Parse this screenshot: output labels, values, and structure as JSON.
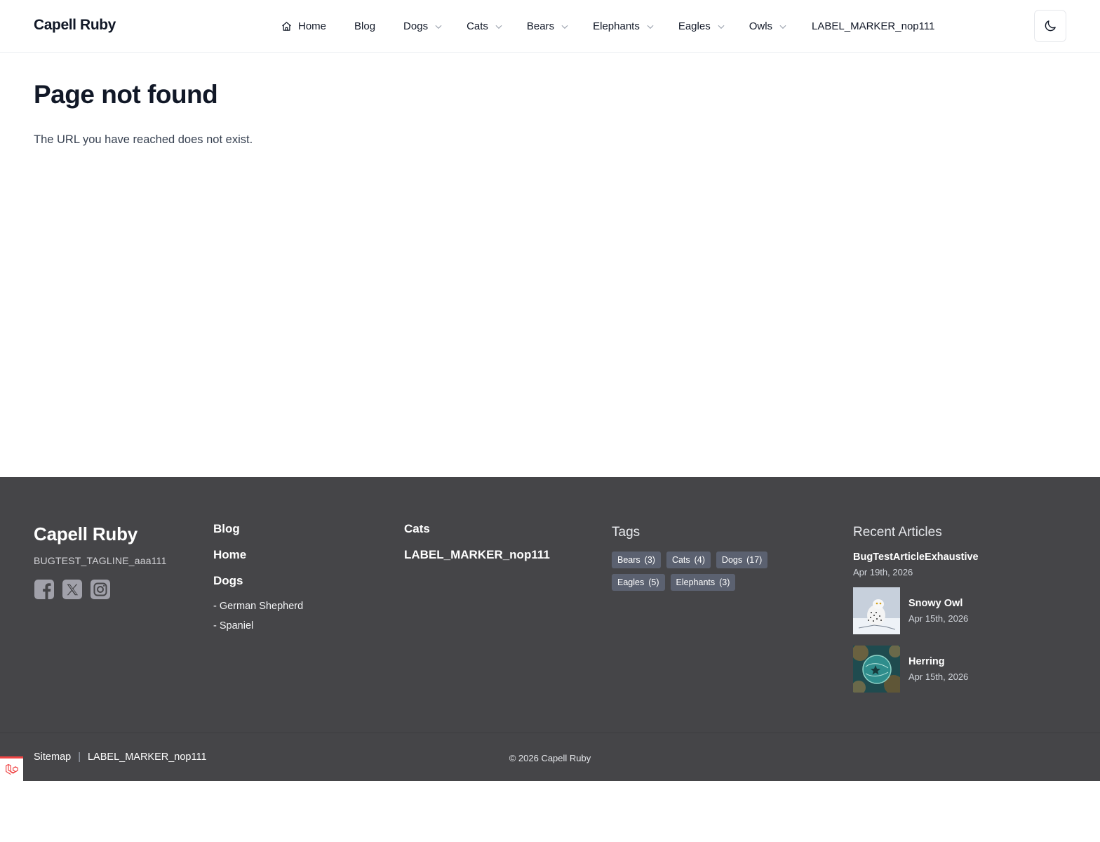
{
  "header": {
    "brand": "Capell Ruby",
    "nav": [
      {
        "label": "Home",
        "icon": "home-icon",
        "dropdown": false
      },
      {
        "label": "Blog",
        "dropdown": false
      },
      {
        "label": "Dogs",
        "dropdown": true
      },
      {
        "label": "Cats",
        "dropdown": true
      },
      {
        "label": "Bears",
        "dropdown": true
      },
      {
        "label": "Elephants",
        "dropdown": true
      },
      {
        "label": "Eagles",
        "dropdown": true
      },
      {
        "label": "Owls",
        "dropdown": true
      },
      {
        "label": "LABEL_MARKER_nop111",
        "dropdown": false
      }
    ],
    "theme_toggle_icon": "moon-icon"
  },
  "main": {
    "title": "Page not found",
    "message": "The URL you have reached does not exist."
  },
  "footer": {
    "brand": "Capell Ruby",
    "tagline": "BUGTEST_TAGLINE_aaa111",
    "social": [
      "facebook-icon",
      "x-icon",
      "instagram-icon"
    ],
    "col1": {
      "links": [
        "Blog",
        "Home",
        "Dogs"
      ],
      "sublinks": [
        "- German Shepherd",
        "- Spaniel"
      ]
    },
    "col2": {
      "links": [
        "Cats",
        "LABEL_MARKER_nop111"
      ]
    },
    "tags": {
      "heading": "Tags",
      "items": [
        {
          "name": "Bears",
          "count": "(3)"
        },
        {
          "name": "Cats",
          "count": "(4)"
        },
        {
          "name": "Dogs",
          "count": "(17)"
        },
        {
          "name": "Eagles",
          "count": "(5)"
        },
        {
          "name": "Elephants",
          "count": "(3)"
        }
      ]
    },
    "recent": {
      "heading": "Recent Articles",
      "items": [
        {
          "title": "BugTestArticleExhaustive",
          "date": "Apr 19th, 2026"
        },
        {
          "title": "Snowy Owl",
          "date": "Apr 15th, 2026"
        },
        {
          "title": "Herring",
          "date": "Apr 15th, 2026"
        }
      ]
    },
    "bottom": {
      "links": [
        "Sitemap",
        "LABEL_MARKER_nop111"
      ],
      "separator": "|",
      "copyright": "© 2026 Capell Ruby"
    },
    "colors": {
      "background": "#454548",
      "tag_bg": "#5b6170"
    }
  }
}
